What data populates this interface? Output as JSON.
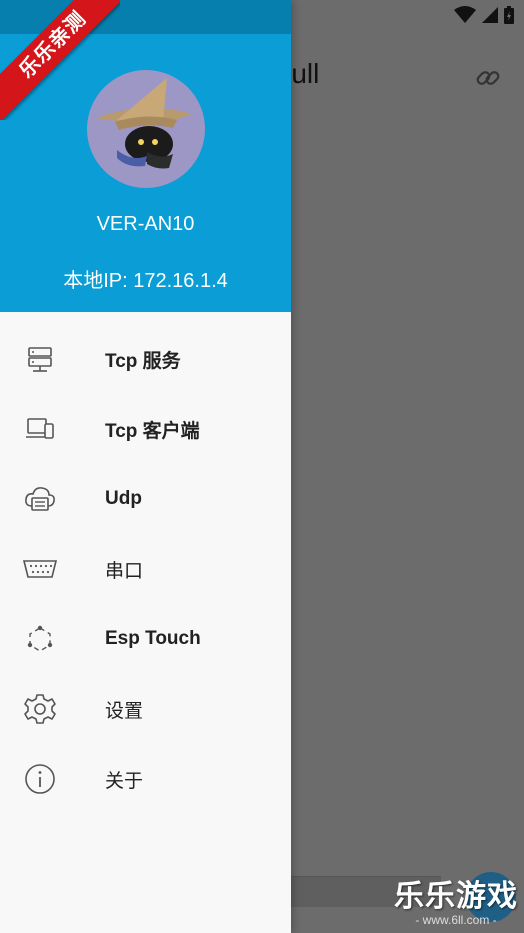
{
  "app": {
    "title_fragment": "tnull"
  },
  "drawer": {
    "device_name": "VER-AN10",
    "local_ip": "本地IP: 172.16.1.4",
    "items": [
      {
        "label": "Tcp 服务",
        "icon": "server-icon"
      },
      {
        "label": "Tcp 客户端",
        "icon": "devices-icon"
      },
      {
        "label": "Udp",
        "icon": "cloud-printer-icon"
      },
      {
        "label": "串口",
        "icon": "serial-port-icon"
      },
      {
        "label": "Esp Touch",
        "icon": "network-nodes-icon"
      },
      {
        "label": "设置",
        "icon": "gear-icon"
      },
      {
        "label": "关于",
        "icon": "info-icon"
      }
    ]
  },
  "watermark": {
    "ribbon": "乐乐亲测",
    "brand": "乐乐游戏",
    "url": "- www.6ll.com -"
  },
  "colors": {
    "header": "#0a9dd6",
    "header_dark": "#077fae",
    "scrim": "#6c6c6c",
    "ribbon": "#d4161b"
  }
}
